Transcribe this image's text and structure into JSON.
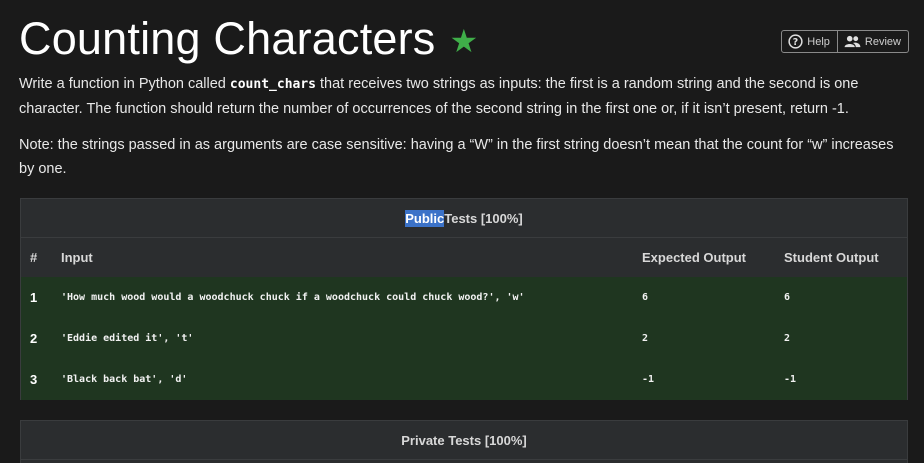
{
  "header": {
    "title": "Counting Characters",
    "star_icon": "star-icon",
    "star_color": "#3fae49",
    "help_label": "Help",
    "review_label": "Review"
  },
  "description": {
    "p1_before": "Write a function in Python called ",
    "p1_code": "count_chars",
    "p1_after": " that receives two strings as inputs: the first is a random string and the second is one character. The function should return the number of occurrences of the second string in the first one or, if it isn’t present, return -1.",
    "p2": "Note: the strings passed in as arguments are case sensitive: having a “W” in the first string doesn’t mean that the count for “w” increases by one."
  },
  "public_tests": {
    "title_highlight": "Public",
    "title_rest": " Tests [100%]",
    "columns": [
      "#",
      "Input",
      "Expected Output",
      "Student Output"
    ],
    "rows": [
      {
        "num": "1",
        "input": "'How much wood would a woodchuck chuck if a woodchuck could chuck wood?', 'w'",
        "expected": "6",
        "student": "6"
      },
      {
        "num": "2",
        "input": "'Eddie edited it', 't'",
        "expected": "2",
        "student": "2"
      },
      {
        "num": "3",
        "input": "'Black back bat', 'd'",
        "expected": "-1",
        "student": "-1"
      }
    ],
    "pass_color": "#1f3620"
  },
  "private_tests": {
    "title": "Private Tests [100%]"
  }
}
